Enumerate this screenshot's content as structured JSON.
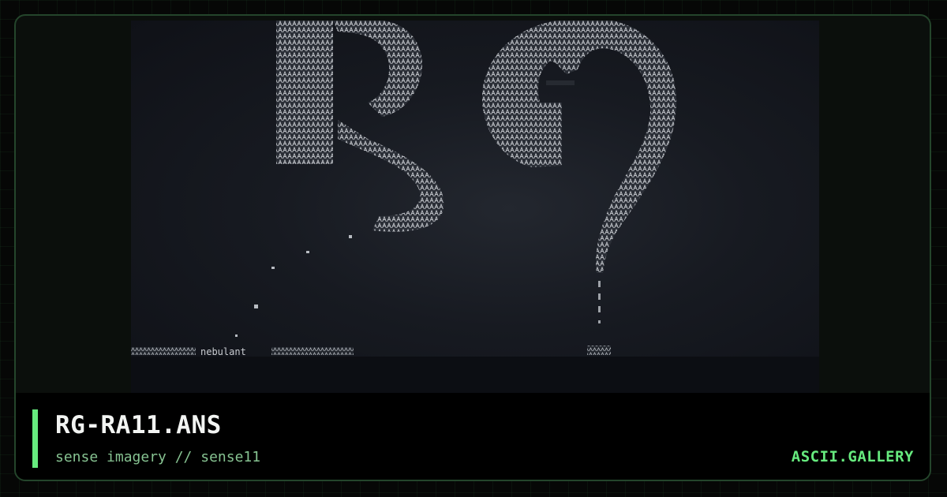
{
  "card": {
    "title": "RG-RA11.ANS",
    "subtitle": "sense imagery // sense11",
    "brand": "ASCII.GALLERY"
  },
  "artwork": {
    "description_icon": "ascii-art-image",
    "footer_text": "nebulant"
  },
  "colors": {
    "accent": "#66ea7e",
    "frame_border": "#24452b",
    "background": "#060706"
  }
}
